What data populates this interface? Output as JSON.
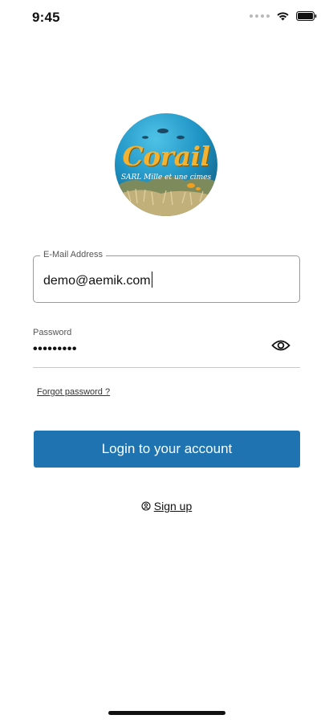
{
  "status_bar": {
    "time": "9:45"
  },
  "logo": {
    "title": "Corail",
    "subtitle": "SARL Mille et une cimes"
  },
  "email": {
    "label": "E-Mail Address",
    "value": "demo@aemik.com"
  },
  "password": {
    "label": "Password",
    "value": "•••••••••",
    "toggle_icon": "eye-icon"
  },
  "forgot_password": {
    "label": "Forgot password ?"
  },
  "login_button": {
    "label": "Login to your account",
    "color": "#1e73b0"
  },
  "signup": {
    "label": "Sign up",
    "icon": "user-plus-icon"
  }
}
